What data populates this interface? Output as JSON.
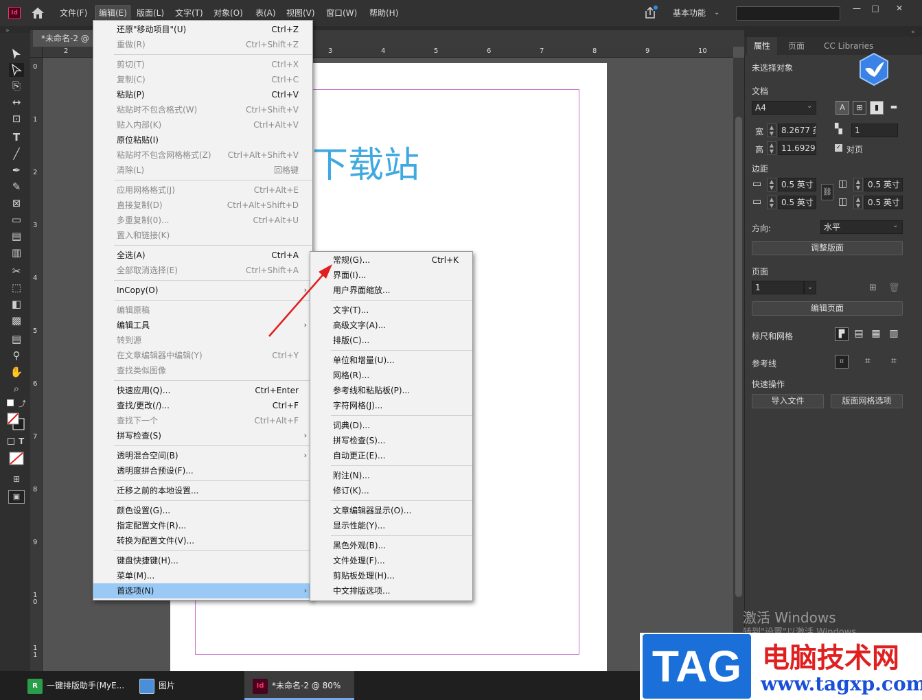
{
  "app": {
    "logo": "Id",
    "doc_title": "*未命名-2 @ 80%"
  },
  "menubar": [
    "文件(F)",
    "编辑(E)",
    "版面(L)",
    "文字(T)",
    "对象(O)",
    "表(A)",
    "视图(V)",
    "窗口(W)",
    "帮助(H)"
  ],
  "workspace": "基本功能",
  "window_buttons": {
    "minimize": "—",
    "maximize": "□",
    "close": "✕"
  },
  "doc_tab": "*未命名-2 @",
  "ruler_h": [
    "2",
    "3",
    "4",
    "5",
    "6",
    "7",
    "8",
    "9",
    "10"
  ],
  "ruler_v": [
    "0",
    "1",
    "2",
    "3",
    "4",
    "5",
    "6",
    "7",
    "8",
    "9",
    "1\n0",
    "1\n1"
  ],
  "page_text": "下载站",
  "edit_menu": [
    {
      "label": "还原\"移动项目\"(U)",
      "shortcut": "Ctrl+Z",
      "disabled": false
    },
    {
      "label": "重做(R)",
      "shortcut": "Ctrl+Shift+Z",
      "disabled": true
    },
    {
      "sep": true
    },
    {
      "label": "剪切(T)",
      "shortcut": "Ctrl+X",
      "disabled": true
    },
    {
      "label": "复制(C)",
      "shortcut": "Ctrl+C",
      "disabled": true
    },
    {
      "label": "粘贴(P)",
      "shortcut": "Ctrl+V",
      "disabled": false
    },
    {
      "label": "粘贴时不包含格式(W)",
      "shortcut": "Ctrl+Shift+V",
      "disabled": true
    },
    {
      "label": "贴入内部(K)",
      "shortcut": "Ctrl+Alt+V",
      "disabled": true
    },
    {
      "label": "原位粘贴(I)",
      "shortcut": "",
      "disabled": false
    },
    {
      "label": "粘贴时不包含网格格式(Z)",
      "shortcut": "Ctrl+Alt+Shift+V",
      "disabled": true
    },
    {
      "label": "清除(L)",
      "shortcut": "回格键",
      "disabled": true
    },
    {
      "sep": true
    },
    {
      "label": "应用网格格式(J)",
      "shortcut": "Ctrl+Alt+E",
      "disabled": true
    },
    {
      "label": "直接复制(D)",
      "shortcut": "Ctrl+Alt+Shift+D",
      "disabled": true
    },
    {
      "label": "多重复制(0)...",
      "shortcut": "Ctrl+Alt+U",
      "disabled": true
    },
    {
      "label": "置入和链接(K)",
      "shortcut": "",
      "disabled": true
    },
    {
      "sep": true
    },
    {
      "label": "全选(A)",
      "shortcut": "Ctrl+A",
      "disabled": false
    },
    {
      "label": "全部取消选择(E)",
      "shortcut": "Ctrl+Shift+A",
      "disabled": true
    },
    {
      "sep": true
    },
    {
      "label": "InCopy(O)",
      "shortcut": "",
      "disabled": false,
      "submenu": true
    },
    {
      "sep": true
    },
    {
      "label": "编辑原稿",
      "shortcut": "",
      "disabled": true
    },
    {
      "label": "编辑工具",
      "shortcut": "",
      "disabled": false,
      "submenu": true
    },
    {
      "label": "转到源",
      "shortcut": "",
      "disabled": true
    },
    {
      "label": "在文章编辑器中编辑(Y)",
      "shortcut": "Ctrl+Y",
      "disabled": true
    },
    {
      "label": "查找类似图像",
      "shortcut": "",
      "disabled": true
    },
    {
      "sep": true
    },
    {
      "label": "快速应用(Q)...",
      "shortcut": "Ctrl+Enter",
      "disabled": false
    },
    {
      "label": "查找/更改(/)...",
      "shortcut": "Ctrl+F",
      "disabled": false
    },
    {
      "label": "查找下一个",
      "shortcut": "Ctrl+Alt+F",
      "disabled": true
    },
    {
      "label": "拼写检查(S)",
      "shortcut": "",
      "disabled": false,
      "submenu": true
    },
    {
      "sep": true
    },
    {
      "label": "透明混合空间(B)",
      "shortcut": "",
      "disabled": false,
      "submenu": true
    },
    {
      "label": "透明度拼合预设(F)...",
      "shortcut": "",
      "disabled": false
    },
    {
      "sep": true
    },
    {
      "label": "迁移之前的本地设置...",
      "shortcut": "",
      "disabled": false
    },
    {
      "sep": true
    },
    {
      "label": "颜色设置(G)...",
      "shortcut": "",
      "disabled": false
    },
    {
      "label": "指定配置文件(R)...",
      "shortcut": "",
      "disabled": false
    },
    {
      "label": "转换为配置文件(V)...",
      "shortcut": "",
      "disabled": false
    },
    {
      "sep": true
    },
    {
      "label": "键盘快捷键(H)...",
      "shortcut": "",
      "disabled": false
    },
    {
      "label": "菜单(M)...",
      "shortcut": "",
      "disabled": false
    },
    {
      "label": "首选项(N)",
      "shortcut": "",
      "disabled": false,
      "submenu": true,
      "highlight": true
    }
  ],
  "pref_menu": [
    {
      "label": "常规(G)...",
      "shortcut": "Ctrl+K"
    },
    {
      "label": "界面(I)...",
      "shortcut": ""
    },
    {
      "label": "用户界面缩放...",
      "shortcut": ""
    },
    {
      "sep": true
    },
    {
      "label": "文字(T)...",
      "shortcut": ""
    },
    {
      "label": "高级文字(A)...",
      "shortcut": ""
    },
    {
      "label": "排版(C)...",
      "shortcut": ""
    },
    {
      "sep": true
    },
    {
      "label": "单位和增量(U)...",
      "shortcut": ""
    },
    {
      "label": "网格(R)...",
      "shortcut": ""
    },
    {
      "label": "参考线和粘贴板(P)...",
      "shortcut": ""
    },
    {
      "label": "字符网格(J)...",
      "shortcut": ""
    },
    {
      "sep": true
    },
    {
      "label": "词典(D)...",
      "shortcut": ""
    },
    {
      "label": "拼写检查(S)...",
      "shortcut": ""
    },
    {
      "label": "自动更正(E)...",
      "shortcut": ""
    },
    {
      "sep": true
    },
    {
      "label": "附注(N)...",
      "shortcut": ""
    },
    {
      "label": "修订(K)...",
      "shortcut": ""
    },
    {
      "sep": true
    },
    {
      "label": "文章编辑器显示(O)...",
      "shortcut": ""
    },
    {
      "label": "显示性能(Y)...",
      "shortcut": ""
    },
    {
      "sep": true
    },
    {
      "label": "黑色外观(B)...",
      "shortcut": ""
    },
    {
      "label": "文件处理(F)...",
      "shortcut": ""
    },
    {
      "label": "剪贴板处理(H)...",
      "shortcut": ""
    },
    {
      "label": "中文排版选项...",
      "shortcut": ""
    }
  ],
  "panel": {
    "tabs": [
      "属性",
      "页面",
      "CC Libraries"
    ],
    "no_selection": "未选择对象",
    "doc_section": "文档",
    "page_size": "A4",
    "width_label": "宽",
    "width_value": "8.2677 英",
    "height_label": "高",
    "height_value": "11.6929",
    "pages_value": "1",
    "facing_label": "对页",
    "margins_section": "边距",
    "margin_top": "0.5 英寸",
    "margin_bottom": "0.5 英寸",
    "margin_left": "0.5 英寸",
    "margin_right": "0.5 英寸",
    "orientation_label": "方向:",
    "orientation_value": "水平",
    "adjust_layout": "调整版面",
    "page_section": "页面",
    "page_value": "1",
    "edit_page": "编辑页面",
    "rulers_grids": "标尺和网格",
    "guides": "参考线",
    "quick_actions": "快速操作",
    "import_file": "导入文件",
    "layout_grid_options": "版面网格选项"
  },
  "watermark": {
    "line1": "激活 Windows",
    "line2": "转到\"设置\"以激活 Windows。"
  },
  "tag_brand": {
    "logo": "TAG",
    "title": "电脑技术网",
    "url": "www.tagxp.com"
  },
  "taskbar": [
    {
      "label": "一键排版助手(MyE...",
      "icon": "R"
    },
    {
      "label": "图片",
      "icon": ""
    },
    {
      "label": "*未命名-2 @ 80%",
      "icon": "Id"
    }
  ],
  "colors": {
    "accent": "#3fa9e0",
    "highlight": "#99c9f4",
    "arrow": "#e02020"
  }
}
